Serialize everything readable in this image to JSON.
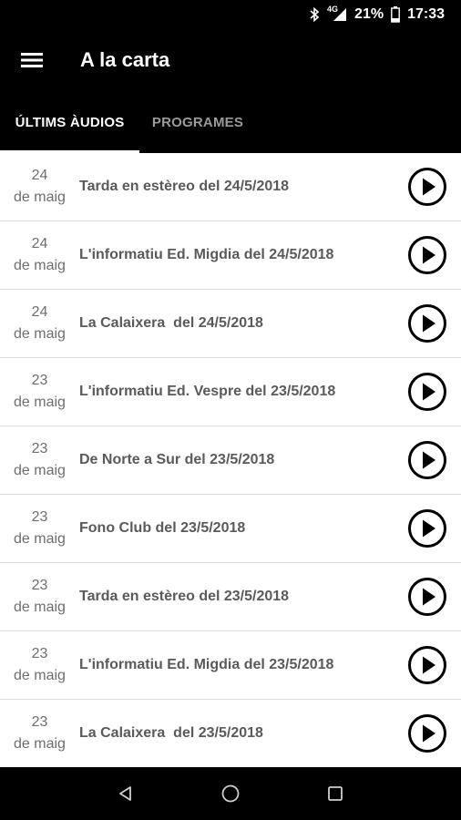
{
  "status_bar": {
    "network": "4G",
    "battery_percent": "21%",
    "time": "17:33",
    "icons": [
      "bluetooth-icon",
      "signal-icon",
      "battery-icon"
    ]
  },
  "app_bar": {
    "title": "A la carta",
    "menu_icon": "hamburger-menu-icon"
  },
  "tabs": [
    {
      "label": "ÚLTIMS ÀUDIOS",
      "active": true
    },
    {
      "label": "PROGRAMES",
      "active": false
    }
  ],
  "episodes": [
    {
      "day": "24",
      "month": "de maig",
      "title": "Tarda en estèreo del 24/5/2018"
    },
    {
      "day": "24",
      "month": "de maig",
      "title": "L'informatiu Ed. Migdia del 24/5/2018"
    },
    {
      "day": "24",
      "month": "de maig",
      "title": "La Calaixera  del 24/5/2018"
    },
    {
      "day": "23",
      "month": "de maig",
      "title": "L'informatiu Ed. Vespre del 23/5/2018"
    },
    {
      "day": "23",
      "month": "de maig",
      "title": "De Norte a Sur del 23/5/2018"
    },
    {
      "day": "23",
      "month": "de maig",
      "title": "Fono Club del 23/5/2018"
    },
    {
      "day": "23",
      "month": "de maig",
      "title": "Tarda en estèreo del 23/5/2018"
    },
    {
      "day": "23",
      "month": "de maig",
      "title": "L'informatiu Ed. Migdia del 23/5/2018"
    },
    {
      "day": "23",
      "month": "de maig",
      "title": "La Calaixera  del 23/5/2018"
    }
  ],
  "nav_bar": {
    "icons": [
      "back-icon",
      "home-icon",
      "recents-icon"
    ]
  }
}
